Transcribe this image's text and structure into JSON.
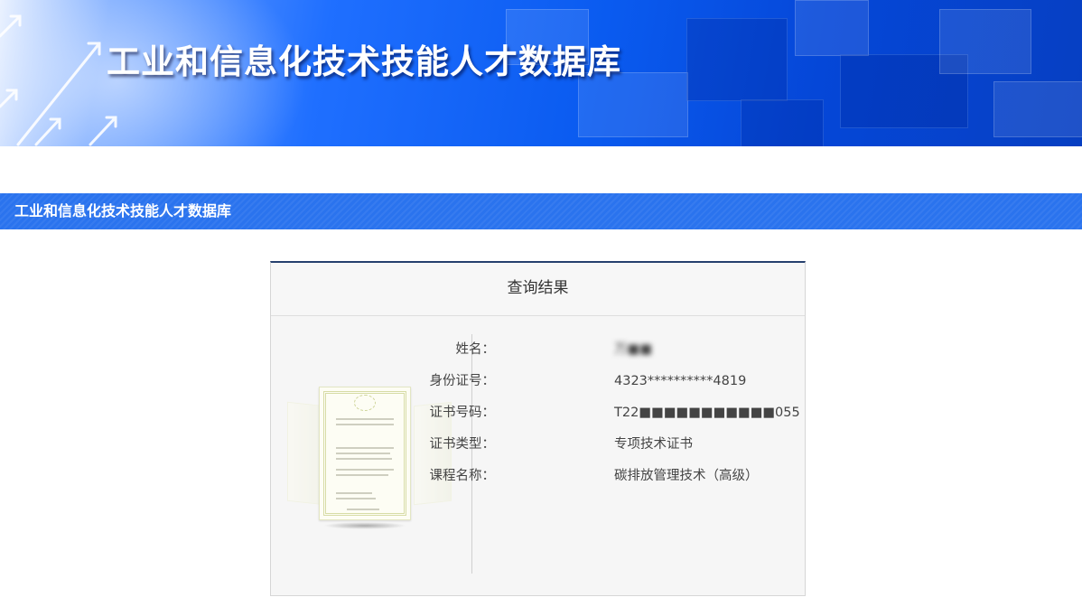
{
  "banner": {
    "title": "工业和信息化技术技能人才数据库"
  },
  "section": {
    "title": "工业和信息化技术技能人才数据库"
  },
  "result": {
    "header": "查询结果",
    "fields": [
      {
        "label": "姓名：",
        "value": "万■■"
      },
      {
        "label": "身份证号：",
        "value": "4323**********4819"
      },
      {
        "label": "证书号码：",
        "value": "T22■■■■■■■■■■■055"
      },
      {
        "label": "证书类型：",
        "value": "专项技术证书"
      },
      {
        "label": "课程名称：",
        "value": "碳排放管理技术（高级）"
      }
    ]
  },
  "colors": {
    "banner_blue": "#0a5bf0",
    "section_bar": "#2a73ee",
    "card_top_border": "#26406e"
  },
  "icons": [
    "certificate-image",
    "arrow-icon"
  ]
}
